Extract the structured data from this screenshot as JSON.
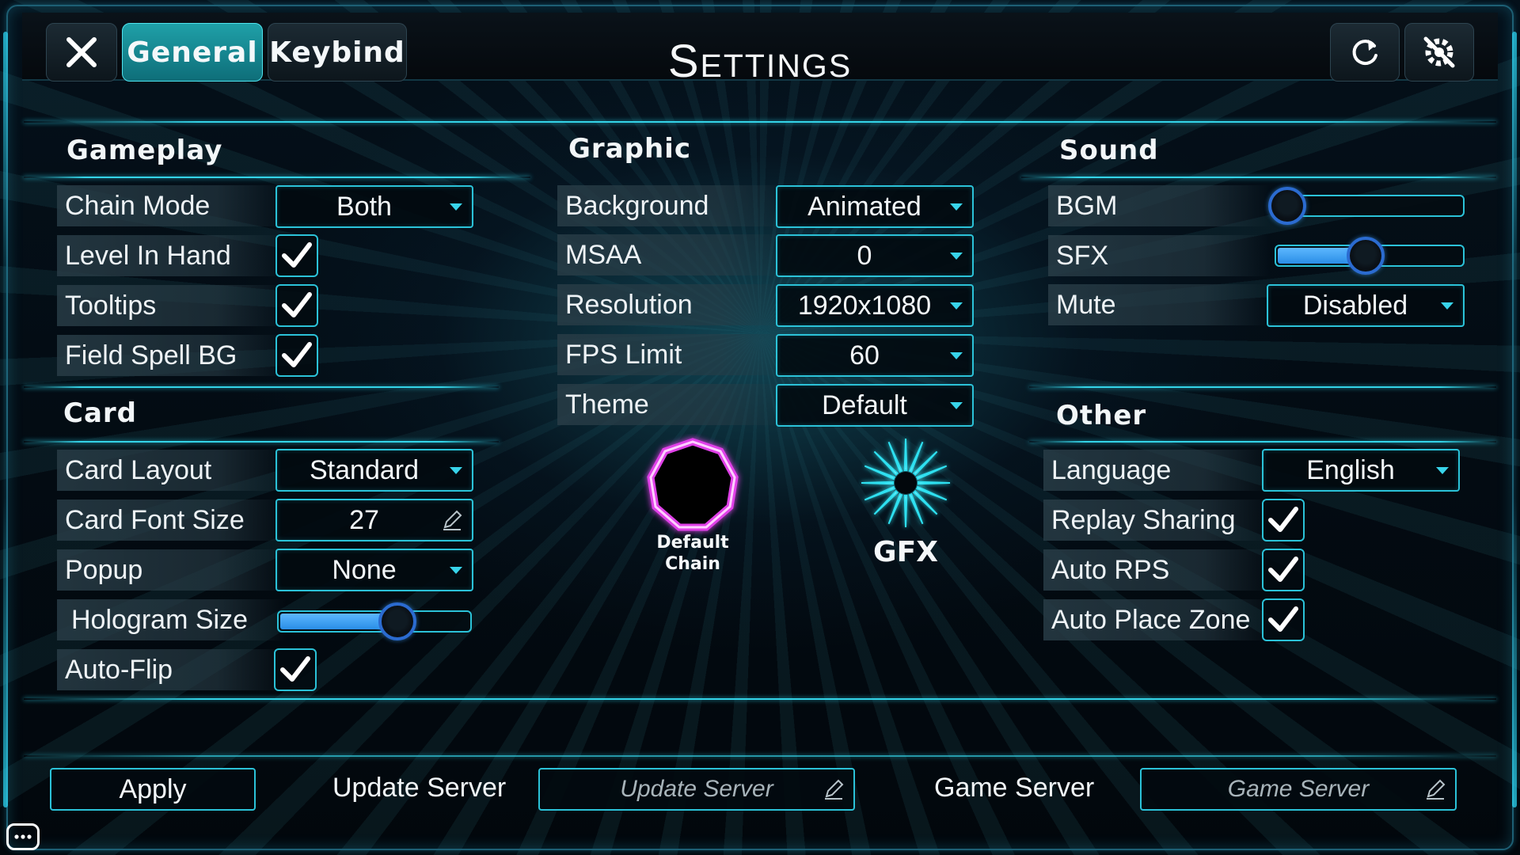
{
  "header": {
    "title": "Settings",
    "tabs": [
      {
        "label": "General",
        "active": true
      },
      {
        "label": "Keybind",
        "active": false
      }
    ],
    "icons": {
      "close": "close-icon",
      "refresh": "refresh-icon",
      "reset": "reset-settings-icon"
    }
  },
  "gameplay": {
    "title": "Gameplay",
    "chain_mode": {
      "label": "Chain Mode",
      "value": "Both"
    },
    "level_in_hand": {
      "label": "Level In Hand",
      "checked": true
    },
    "tooltips": {
      "label": "Tooltips",
      "checked": true
    },
    "field_spell_bg": {
      "label": "Field Spell BG",
      "checked": true
    }
  },
  "card": {
    "title": "Card",
    "card_layout": {
      "label": "Card Layout",
      "value": "Standard"
    },
    "card_font_size": {
      "label": "Card Font Size",
      "value": "27"
    },
    "popup": {
      "label": "Popup",
      "value": "None"
    },
    "hologram_size": {
      "label": "Hologram Size",
      "level": 0.62
    },
    "auto_flip": {
      "label": "Auto-Flip",
      "checked": true
    }
  },
  "graphic": {
    "title": "Graphic",
    "background": {
      "label": "Background",
      "value": "Animated"
    },
    "msaa": {
      "label": "MSAA",
      "value": "0"
    },
    "resolution": {
      "label": "Resolution",
      "value": "1920x1080"
    },
    "fps_limit": {
      "label": "FPS Limit",
      "value": "60"
    },
    "theme": {
      "label": "Theme",
      "value": "Default"
    },
    "chain_icon": {
      "caption_line1": "Default",
      "caption_line2": "Chain"
    },
    "gfx_icon": {
      "caption": "GFX"
    }
  },
  "sound": {
    "title": "Sound",
    "bgm": {
      "label": "BGM",
      "level": 0.0
    },
    "sfx": {
      "label": "SFX",
      "level": 0.48
    },
    "mute": {
      "label": "Mute",
      "value": "Disabled"
    }
  },
  "other": {
    "title": "Other",
    "language": {
      "label": "Language",
      "value": "English"
    },
    "replay_sharing": {
      "label": "Replay Sharing",
      "checked": true
    },
    "auto_rps": {
      "label": "Auto RPS",
      "checked": true
    },
    "auto_place_zone": {
      "label": "Auto Place Zone",
      "checked": true
    }
  },
  "footer": {
    "apply_label": "Apply",
    "update_server_label": "Update Server",
    "update_server_placeholder": "Update Server",
    "game_server_label": "Game Server",
    "game_server_placeholder": "Game Server"
  },
  "colors": {
    "accent": "#2bc2d8",
    "tab_active": "#1fa0a8",
    "slider_fill": "#3a9cf0",
    "chain_icon": "#e040e8"
  }
}
